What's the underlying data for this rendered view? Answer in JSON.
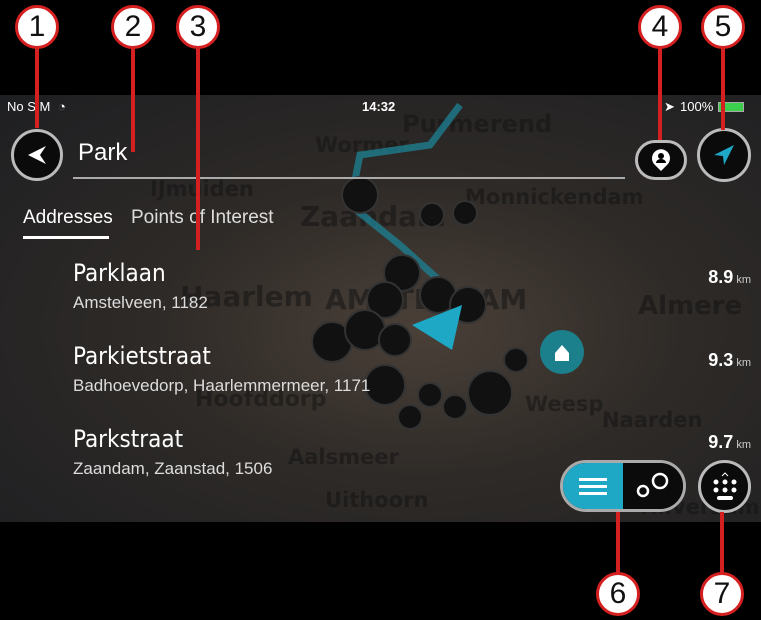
{
  "status": {
    "carrier": "No SIM",
    "time": "14:32",
    "battery": "100%"
  },
  "search": {
    "value": "Park"
  },
  "tabs": [
    {
      "label": "Addresses",
      "active": true
    },
    {
      "label": "Points of Interest",
      "active": false
    }
  ],
  "results": [
    {
      "name": "Parklaan",
      "detail": "Amstelveen, 1182",
      "distance": "8.9",
      "unit": "km"
    },
    {
      "name": "Parkietstraat",
      "detail": "Badhoevedorp, Haarlemmermeer, 1171",
      "distance": "9.3",
      "unit": "km"
    },
    {
      "name": "Parkstraat",
      "detail": "Zaandam, Zaanstad, 1506",
      "distance": "9.7",
      "unit": "km"
    }
  ],
  "map_labels": [
    "Purmerend",
    "Wormer",
    "IJmuiden",
    "Zaandam",
    "Monnickendam",
    "Haarlem",
    "AMSTERDAM",
    "Almere",
    "Hoofddorp",
    "Weesp",
    "Naarden",
    "Aalsmeer",
    "Uithoorn",
    "Hilversum"
  ],
  "callouts": [
    "1",
    "2",
    "3",
    "4",
    "5",
    "6",
    "7"
  ],
  "colors": {
    "accent": "#1ea8c6",
    "callout": "#d42020",
    "battery": "#3ccf4e"
  }
}
